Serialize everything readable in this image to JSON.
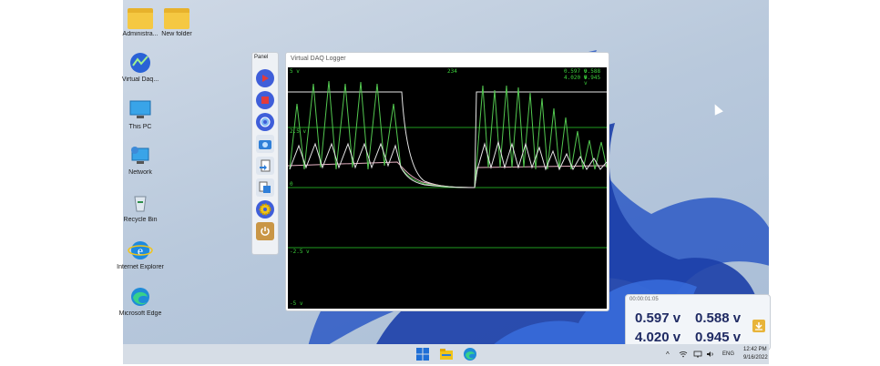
{
  "desktop_icons": [
    {
      "name": "folder-icon",
      "label": "Administra..."
    },
    {
      "name": "folder-icon",
      "label": "New folder"
    },
    {
      "name": "virtual-daq-icon",
      "label": "Virtual Daq..."
    },
    {
      "name": "this-pc-icon",
      "label": "This PC"
    },
    {
      "name": "network-icon",
      "label": "Network"
    },
    {
      "name": "recycle-bin-icon",
      "label": "Recycle Bin"
    },
    {
      "name": "internet-explorer-icon",
      "label": "Internet Explorer"
    },
    {
      "name": "microsoft-edge-icon",
      "label": "Microsoft Edge"
    }
  ],
  "panel": {
    "title": "Panel",
    "buttons": [
      "play-icon",
      "stop-icon",
      "settings-icon",
      "camera-icon",
      "export-icon",
      "data-file-icon",
      "gear-icon",
      "power-icon"
    ]
  },
  "daq_window": {
    "title": "Virtual DAQ Logger",
    "counter": "234",
    "readout": {
      "r1c1": "0.597 v",
      "r1c2": "0.588 v",
      "r2c1": "4.020 v",
      "r2c2": "0.945 v"
    },
    "y_labels": {
      "top": "5 v",
      "mid_upper": "2.5 v",
      "zero": "0",
      "mid_lower": "-2.5 v",
      "bottom": "-5 v"
    }
  },
  "small_panel": {
    "title": "00:00:01:05",
    "values": {
      "v1": "0.597 v",
      "v2": "0.588 v",
      "v3": "4.020 v",
      "v4": "0.945 v"
    }
  },
  "taskbar": {
    "language": "ENG",
    "time": "12:42 PM",
    "date": "9/16/2022"
  },
  "colors": {
    "trace_green": "#53c850",
    "trace_white": "#e6e6e6",
    "trace_pink": "#e7b3c4",
    "grid_green": "#1f9b1f",
    "value_text": "#1f2a63"
  }
}
